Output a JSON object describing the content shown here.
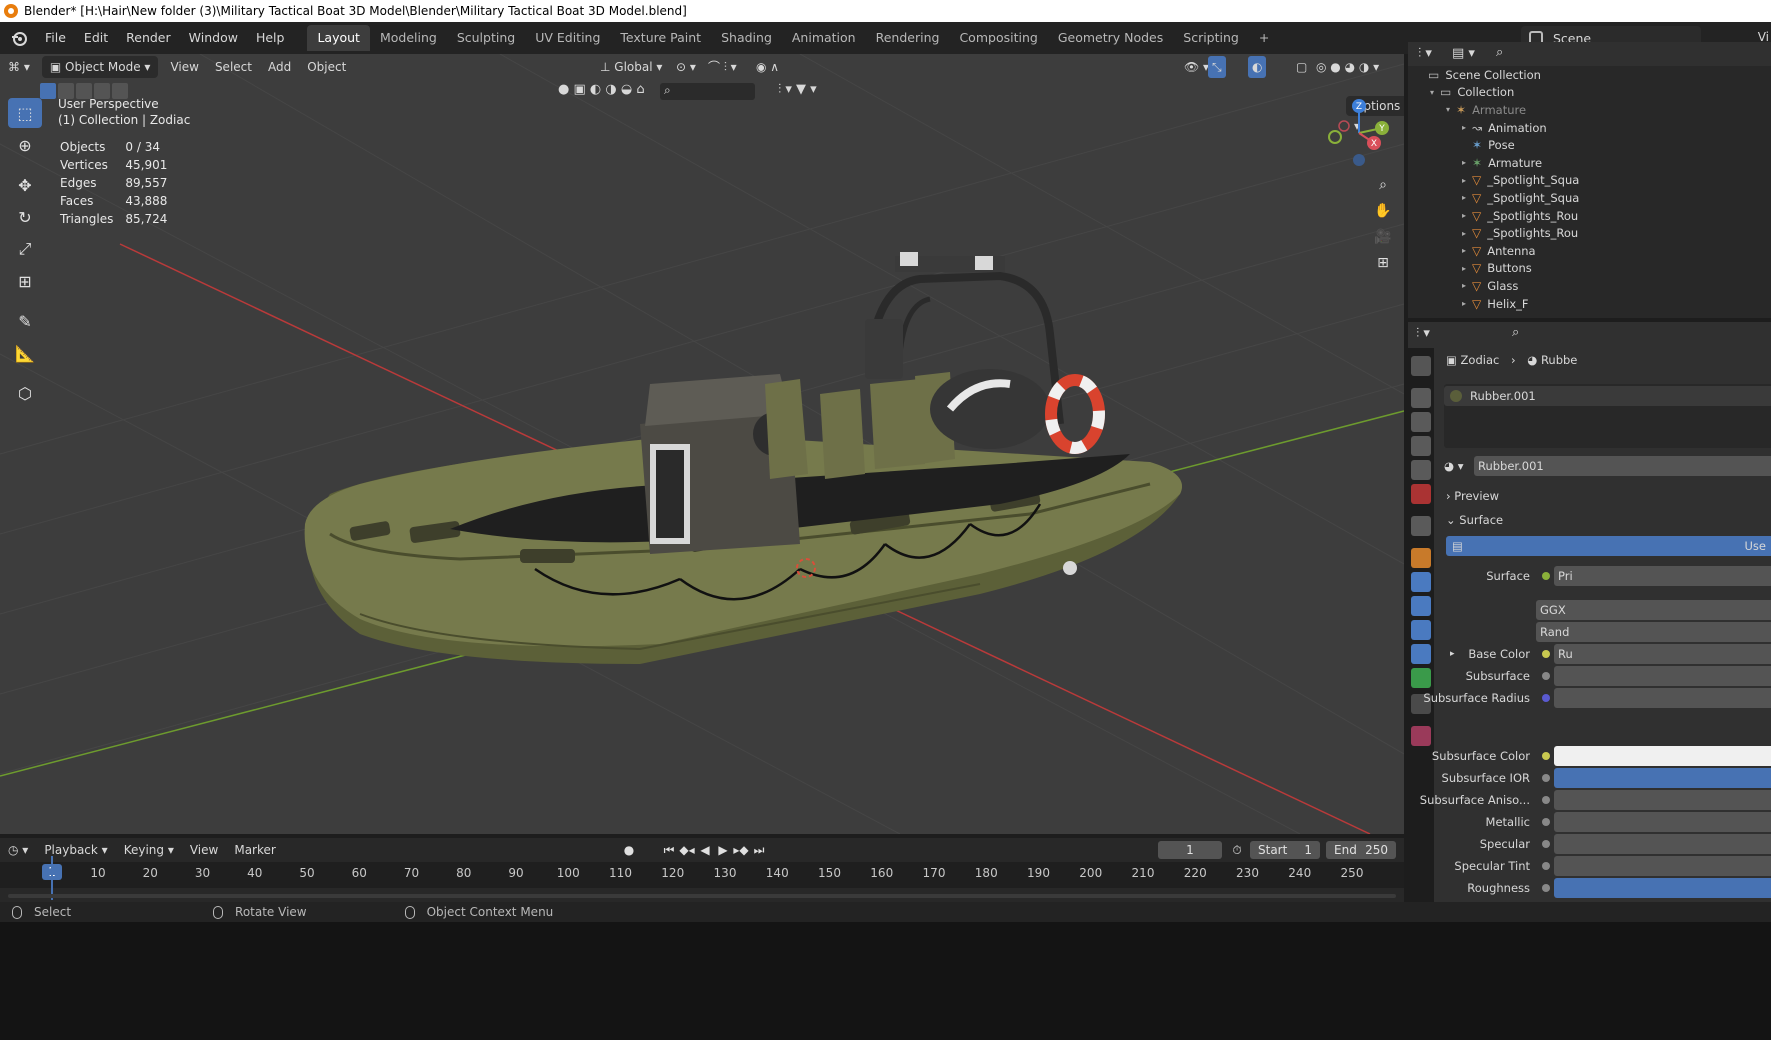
{
  "window": {
    "title": "Blender* [H:\\Hair\\New folder (3)\\Military Tactical Boat 3D Model\\Blender\\Military Tactical Boat 3D Model.blend]"
  },
  "menubar": {
    "menus": [
      "File",
      "Edit",
      "Render",
      "Window",
      "Help"
    ],
    "workspaces": [
      "Layout",
      "Modeling",
      "Sculpting",
      "UV Editing",
      "Texture Paint",
      "Shading",
      "Animation",
      "Rendering",
      "Compositing",
      "Geometry Nodes",
      "Scripting"
    ],
    "active_workspace": "Layout",
    "add_tab": "+",
    "scene": "Scene",
    "view_layer": "Vi"
  },
  "viewport": {
    "mode": "Object Mode",
    "menus": [
      "View",
      "Select",
      "Add",
      "Object"
    ],
    "orientation": "Global",
    "options": "Options",
    "perspective": "User Perspective",
    "context": "(1) Collection | Zodiac",
    "stats": [
      {
        "label": "Objects",
        "value": "0 / 34"
      },
      {
        "label": "Vertices",
        "value": "45,901"
      },
      {
        "label": "Edges",
        "value": "89,557"
      },
      {
        "label": "Faces",
        "value": "43,888"
      },
      {
        "label": "Triangles",
        "value": "85,724"
      }
    ],
    "gizmo_axes": {
      "x": "X",
      "y": "Y",
      "z": "Z"
    },
    "colors": {
      "background": "#3d3d3d",
      "grid": "#454545",
      "x_axis": "#b93a3a",
      "y_axis": "#6d9b2e",
      "boat_hull": "#6b6f45",
      "accent": "#4772b3"
    }
  },
  "timeline": {
    "menus": [
      "Playback",
      "Keying",
      "View",
      "Marker"
    ],
    "current_frame": "1",
    "start_label": "Start",
    "start": "1",
    "end_label": "End",
    "end": "250",
    "ticks": [
      "1",
      "10",
      "20",
      "30",
      "40",
      "50",
      "60",
      "70",
      "80",
      "90",
      "100",
      "110",
      "120",
      "130",
      "140",
      "150",
      "160",
      "170",
      "180",
      "190",
      "200",
      "210",
      "220",
      "230",
      "240",
      "250"
    ]
  },
  "statusbar": {
    "items": [
      "Select",
      "Rotate View",
      "Object Context Menu"
    ]
  },
  "outliner": {
    "rows": [
      {
        "label": "Scene Collection",
        "icon": "collection-icon"
      },
      {
        "label": "Collection",
        "icon": "collection-icon"
      },
      {
        "label": "Armature",
        "icon": "armature-icon"
      },
      {
        "label": "Animation",
        "icon": "animation-icon"
      },
      {
        "label": "Pose",
        "icon": "pose-icon"
      },
      {
        "label": "Armature",
        "icon": "armature-data-icon"
      },
      {
        "label": "_Spotlight_Squa",
        "icon": "mesh-icon"
      },
      {
        "label": "_Spotlight_Squa",
        "icon": "mesh-icon"
      },
      {
        "label": "_Spotlights_Rou",
        "icon": "mesh-icon"
      },
      {
        "label": "_Spotlights_Rou",
        "icon": "mesh-icon"
      },
      {
        "label": "Antenna",
        "icon": "mesh-icon"
      },
      {
        "label": "Buttons",
        "icon": "mesh-icon"
      },
      {
        "label": "Glass",
        "icon": "mesh-icon"
      },
      {
        "label": "Helix_F",
        "icon": "mesh-icon"
      }
    ]
  },
  "properties": {
    "breadcrumb": [
      "Zodiac",
      "Rubbe"
    ],
    "material_slot": "Rubber.001",
    "material_name": "Rubber.001",
    "preview_label": "Preview",
    "surface_label": "Surface",
    "use_nodes_label": "Use",
    "rows": [
      {
        "label": "Surface",
        "value": "Pri"
      },
      {
        "label": "",
        "value": "GGX"
      },
      {
        "label": "",
        "value": "Rand"
      },
      {
        "label": "Base Color",
        "value": "Ru"
      },
      {
        "label": "Subsurface",
        "value": ""
      },
      {
        "label": "Subsurface Radius",
        "value": ""
      },
      {
        "label": "Subsurface Color",
        "value": ""
      },
      {
        "label": "Subsurface IOR",
        "value": ""
      },
      {
        "label": "Subsurface Aniso...",
        "value": ""
      },
      {
        "label": "Metallic",
        "value": ""
      },
      {
        "label": "Specular",
        "value": ""
      },
      {
        "label": "Specular Tint",
        "value": ""
      },
      {
        "label": "Roughness",
        "value": ""
      }
    ]
  }
}
